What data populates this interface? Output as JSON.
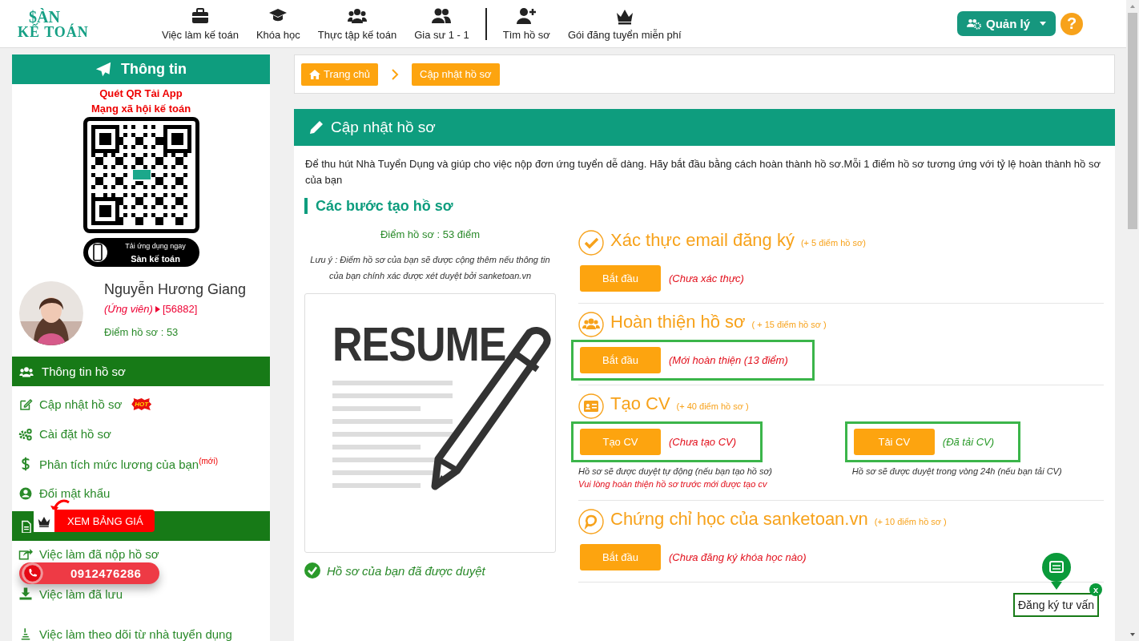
{
  "logo": {
    "line_1": "$ÀN",
    "line_2": "KẾ TOÁN"
  },
  "nav_groups": [
    [
      {
        "label": "Việc làm kế toán"
      },
      {
        "label": "Khóa học"
      },
      {
        "label": "Thực tập kế toán"
      },
      {
        "label": "Gia sư 1 - 1"
      }
    ],
    [
      {
        "label": "Tìm hồ sơ"
      },
      {
        "label": "Gói đăng tuyển miễn phí"
      }
    ]
  ],
  "manage_button": {
    "label": "Quản lý"
  },
  "help_button": {
    "label": "?"
  },
  "sidebar": {
    "title": "Thông tin",
    "qr_caption": [
      "Quét QR Tải App",
      "Mạng xã hội kế toán"
    ],
    "app_badge": {
      "line_1": "Tải ứng dụng ngay",
      "line_2": "Sàn kế toán"
    },
    "profile": {
      "name": "Nguyễn Hương Giang",
      "role": "(Ứng viên)",
      "id": "[56882]",
      "score": "Điểm hồ sơ : 53"
    },
    "sections": [
      {
        "title": "Thông tin hồ sơ",
        "items": [
          {
            "label": "Cập nhật hồ sơ",
            "badge": "HOT"
          },
          {
            "label": "Cài đặt hồ sơ"
          },
          {
            "label": "Phân tích mức lương của bạn$^{(mới)}$"
          },
          {
            "label": "Đổi mật khẩu"
          }
        ]
      },
      {
        "items": [
          {
            "label": "Việc làm đã nộp hồ sơ"
          },
          {
            "label": "Việc làm đã lưu"
          },
          {
            "label": "Việc làm theo dõi từ nhà tuyển dụng"
          }
        ]
      }
    ]
  },
  "promo_badge": {
    "label": "XEM BẢNG GIÁ"
  },
  "phone_button": {
    "label": "0912476286"
  },
  "breadcrumb": [
    {
      "label": "Trang chủ"
    },
    {
      "label": "Cập nhật hồ sơ"
    }
  ],
  "card": {
    "title": "Cập nhật hồ sơ",
    "intro": "Để thu hút Nhà Tuyển Dụng và giúp cho việc nộp đơn ứng tuyển dễ dàng. Hãy bắt đầu bằng cách hoàn thành hồ sơ.Mỗi 1 điểm hồ sơ tương ứng với tỷ lệ hoàn thành hồ sơ của bạn",
    "section_title": "Các bước tạo hồ sơ",
    "score": "Điểm hồ sơ : 53 điểm",
    "note": "Lưu ý : Điểm hồ sơ của bạn sẽ được cộng thêm nếu thông tin của bạn chính xác được xét duyệt bởi sanketoan.vn",
    "resume_title": "RESUME",
    "approved": "Hồ sơ của bạn đã được duyệt",
    "steps": [
      {
        "kind": "email",
        "title": "Xác thực email đăng ký",
        "points": "(+ 5 điểm hồ sơ)",
        "actions": [
          {
            "button": "Bắt đầu",
            "status": "(Chưa xác thực)",
            "done": false,
            "highlighted": false
          }
        ]
      },
      {
        "kind": "profile",
        "title": "Hoàn thiện hồ sơ",
        "points": "( + 15 điểm hồ sơ )",
        "actions": [
          {
            "button": "Bắt đầu",
            "status": "(Mới hoàn thiện (13 điểm)",
            "done": false,
            "highlighted": true
          }
        ]
      },
      {
        "kind": "cv",
        "title": "Tạo CV",
        "points": "(+ 40 điểm hồ sơ )",
        "actions": [
          {
            "button": "Tạo CV",
            "status": "(Chưa tạo CV)",
            "done": false,
            "highlighted": true,
            "notes": [
              {
                "text": "Hồ sơ sẽ được duyệt tự động (nếu bạn tạo hồ sơ)",
                "warning": false
              },
              {
                "text": "Vui lòng hoàn thiện hồ sơ trước mới được tạo cv",
                "warning": true
              }
            ]
          },
          {
            "button": "Tải CV",
            "status": "(Đã tải CV)",
            "done": true,
            "highlighted": true,
            "notes": [
              {
                "text": "Hồ sơ sẽ được duyệt trong vòng 24h (nếu bạn tải CV)",
                "warning": false
              }
            ]
          }
        ]
      },
      {
        "kind": "certificate",
        "title": "Chứng chỉ học của sanketoan.vn",
        "points": "(+ 10 điểm hồ sơ )",
        "actions": [
          {
            "button": "Bắt đầu",
            "status": "(Chưa đăng ký khóa học nào)",
            "done": false,
            "highlighted": false
          }
        ]
      }
    ]
  },
  "consult_widget": {
    "label": "Đăng ký tư vấn",
    "close": "x"
  }
}
